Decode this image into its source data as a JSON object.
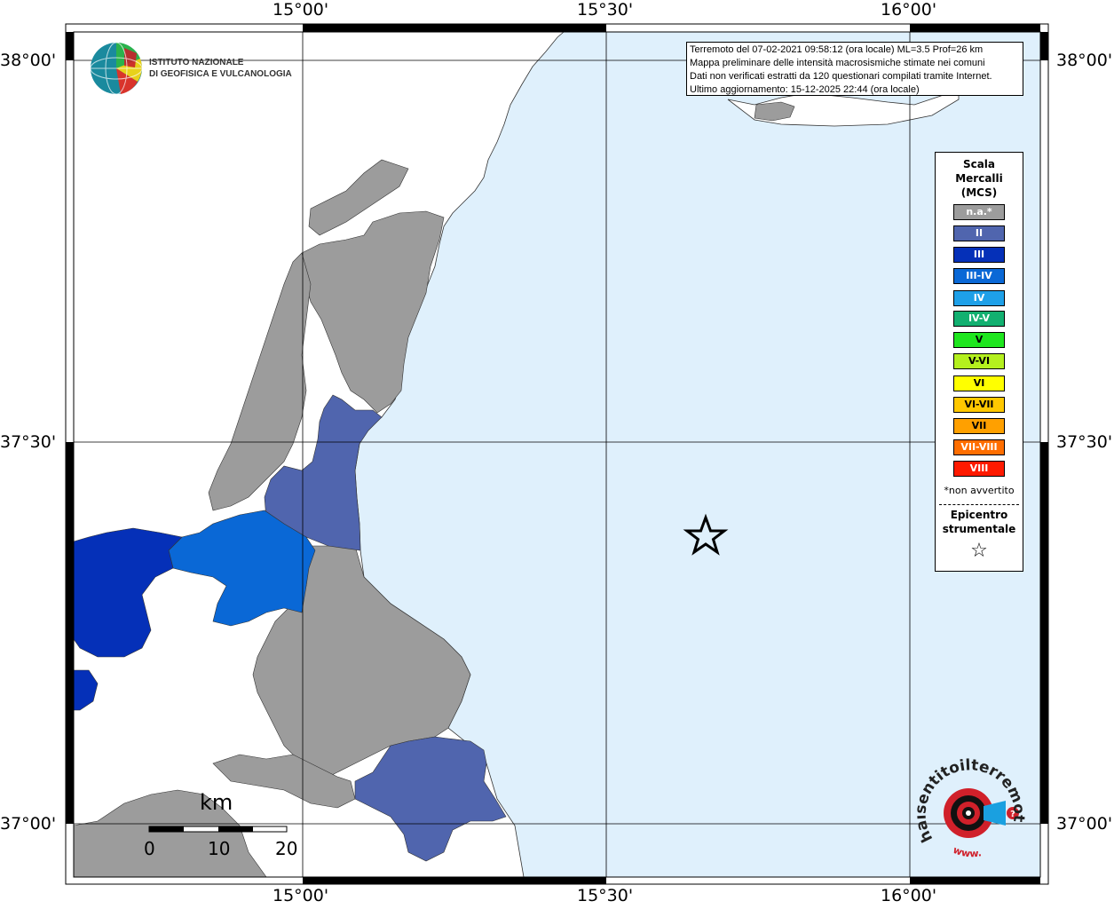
{
  "axes": {
    "top": [
      "15°00'",
      "15°30'",
      "16°00'"
    ],
    "bottom": [
      "15°00'",
      "15°30'",
      "16°00'"
    ],
    "left": [
      "38°00'",
      "37°30'",
      "37°00'"
    ],
    "right": [
      "38°00'",
      "37°30'",
      "37°00'"
    ]
  },
  "info_box": {
    "line1": "Terremoto del 07-02-2021 09:58:12 (ora locale) ML=3.5 Prof=26 km",
    "line2": "Mappa preliminare delle intensità macrosismiche stimate nei comuni",
    "line3": "Dati non verificati estratti da 120 questionari compilati tramite Internet.",
    "line4": "Ultimo aggiornamento: 15-12-2025 22:44 (ora locale)"
  },
  "ingv": {
    "line1": "ISTITUTO NAZIONALE",
    "line2": "DI GEOFISICA E VULCANOLOGIA"
  },
  "legend": {
    "title1": "Scala",
    "title2": "Mercalli",
    "title3": "(MCS)",
    "classes": [
      {
        "label": "n.a.*",
        "color": "#9c9c9c"
      },
      {
        "label": "II",
        "color": "#5065ae"
      },
      {
        "label": "III",
        "color": "#0530b8"
      },
      {
        "label": "III-IV",
        "color": "#0a68d6"
      },
      {
        "label": "IV",
        "color": "#1ea0e8"
      },
      {
        "label": "IV-V",
        "color": "#12b070"
      },
      {
        "label": "V",
        "color": "#1ee61e"
      },
      {
        "label": "V-VI",
        "color": "#b4f01e"
      },
      {
        "label": "VI",
        "color": "#ffff00"
      },
      {
        "label": "VI-VII",
        "color": "#ffc800"
      },
      {
        "label": "VII",
        "color": "#ffa000"
      },
      {
        "label": "VII-VIII",
        "color": "#ff6e00"
      },
      {
        "label": "VIII",
        "color": "#ff1a00"
      }
    ],
    "na_note": "*non avvertito",
    "epi1": "Epicentro",
    "epi2": "strumentale",
    "epi_symbol": "☆"
  },
  "scalebar": {
    "unit": "km",
    "ticks": [
      "0",
      "10",
      "20"
    ]
  },
  "hai": {
    "text_main": "haisentitoilterremoto.it",
    "text_www": "www.",
    "question": "?"
  },
  "colors": {
    "sea": "#dff0fc",
    "land_na": "#9c9c9c",
    "land_white": "#ffffff",
    "mcs_II": "#5065ae",
    "mcs_III": "#0530b8",
    "mcs_IIIIV": "#0a68d6"
  }
}
